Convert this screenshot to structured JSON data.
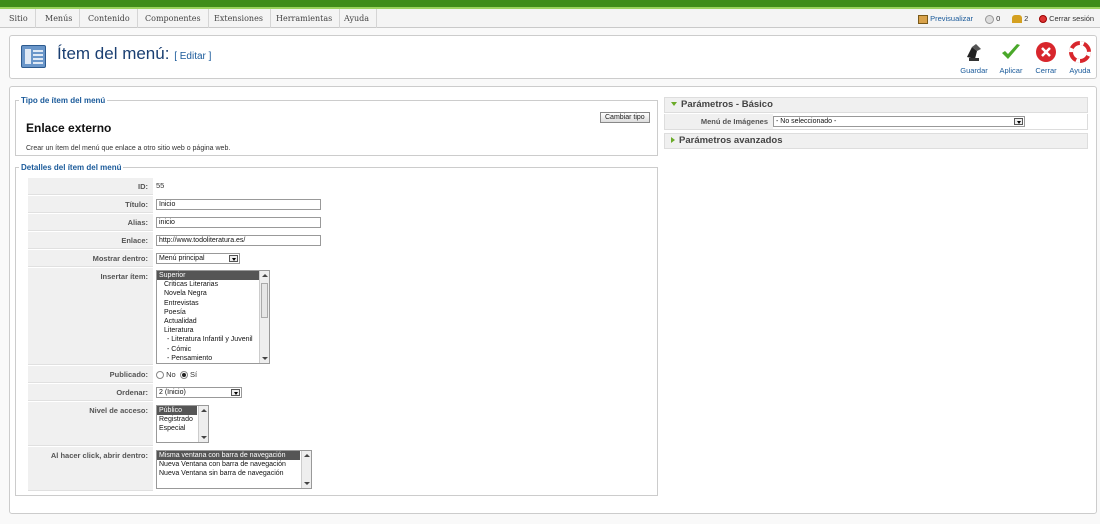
{
  "menu": [
    "Sitio",
    "Menús",
    "Contenido",
    "Componentes",
    "Extensiones",
    "Herramientas",
    "Ayuda"
  ],
  "status": {
    "preview": "Previsualizar",
    "messages": "0",
    "users": "2",
    "logout": "Cerrar sesión"
  },
  "header": {
    "title": "Ítem del menú:",
    "subtitle": "[ Editar ]"
  },
  "toolbar": {
    "save": "Guardar",
    "apply": "Aplicar",
    "close": "Cerrar",
    "help": "Ayuda"
  },
  "type_box": {
    "legend": "Tipo de ítem del menú",
    "name": "Enlace externo",
    "description": "Crear un ítem del menú que enlace a otro sitio web o página web.",
    "change_button": "Cambiar tipo"
  },
  "details": {
    "legend": "Detalles del ítem del menú",
    "id_label": "ID:",
    "id_value": "55",
    "title_label": "Título:",
    "title_value": "Inicio",
    "alias_label": "Alias:",
    "alias_value": "inicio",
    "link_label": "Enlace:",
    "link_value": "http://www.todoliteratura.es/",
    "show_in_label": "Mostrar dentro:",
    "show_in_value": "Menú principal",
    "parent_label": "Insertar ítem:",
    "parent_options": [
      "Superior",
      "  Criticas Literarias",
      "  Novela Negra",
      "  Entrevistas",
      "  Poesía",
      "  Actualidad",
      "  Literatura",
      "   - Literatura Infantil y Juvenil",
      "   - Cómic",
      "   - Pensamiento"
    ],
    "published_label": "Publicado:",
    "published_no": "No",
    "published_yes": "Sí",
    "order_label": "Ordenar:",
    "order_value": "2 (Inicio)",
    "access_label": "Nivel de acceso:",
    "access_options": [
      "Público",
      "Registrado",
      "Especial"
    ],
    "browser_nav_label": "Al hacer click, abrir dentro:",
    "browser_nav_options": [
      "Misma ventana con barra de navegación",
      "Nueva Ventana con barra de navegación",
      "Nueva Ventana sin barra de navegación"
    ]
  },
  "params": {
    "basic_title": "Parámetros - Básico",
    "menu_image_label": "Menú de Imágenes",
    "menu_image_value": "- No seleccionado -",
    "advanced_title": "Parámetros avanzados"
  },
  "colors": {
    "accent": "#3f8d1a",
    "link": "#1a5a9a",
    "title": "#1a3f72"
  }
}
